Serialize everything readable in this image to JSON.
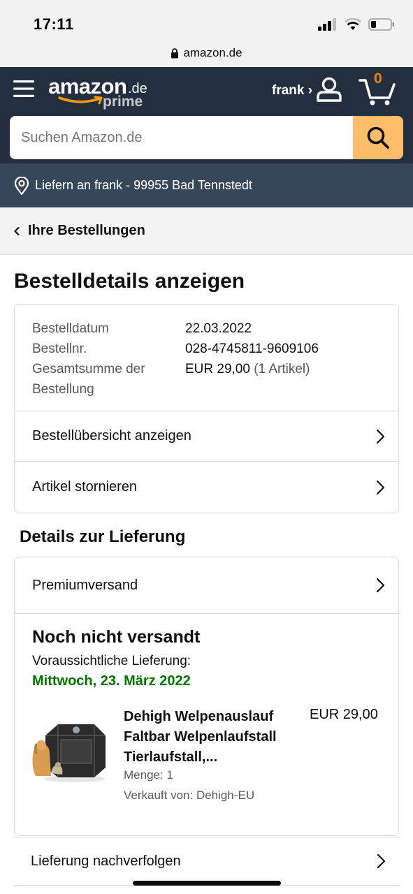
{
  "status_bar": {
    "time": "17:11"
  },
  "browser": {
    "url": "amazon.de"
  },
  "header": {
    "logo_word": "amazon",
    "logo_tld": ".de",
    "logo_sub": "prime",
    "user_name": "frank ›",
    "cart_count": "0"
  },
  "search": {
    "placeholder": "Suchen Amazon.de"
  },
  "deliver": {
    "text": "Liefern an frank - 99955 Bad Tennstedt"
  },
  "breadcrumb": {
    "label": "Ihre Bestellungen"
  },
  "page": {
    "title": "Bestelldetails anzeigen"
  },
  "order": {
    "date_label": "Bestelldatum",
    "date_value": "22.03.2022",
    "number_label": "Bestellnr.",
    "number_value": "028-4745811-9609106",
    "total_label_line1": "Gesamtsumme der",
    "total_label_line2": "Bestellung",
    "total_value": "EUR 29,00",
    "total_items": "(1 Artikel)",
    "actions": [
      {
        "label": "Bestellübersicht anzeigen"
      },
      {
        "label": "Artikel stornieren"
      }
    ]
  },
  "delivery": {
    "section_title": "Details zur Lieferung",
    "method": "Premiumversand",
    "status": "Noch nicht versandt",
    "expected_label": "Voraussichtliche Lieferung:",
    "expected_date": "Mittwoch, 23. März 2022",
    "product": {
      "title_line1": "Dehigh Welpenauslauf",
      "title_line2": "Faltbar Welpenlaufstall",
      "title_line3": "Tierlaufstall,...",
      "price": "EUR 29,00",
      "quantity": "Menge: 1",
      "seller": "Verkauft von: Dehigh-EU"
    },
    "track_label": "Lieferung nachverfolgen"
  },
  "colors": {
    "header_bg": "#232f3e",
    "deliver_bg": "#37475a",
    "search_button": "#febd69",
    "cart_count": "#f08804",
    "delivery_date": "#007600"
  }
}
